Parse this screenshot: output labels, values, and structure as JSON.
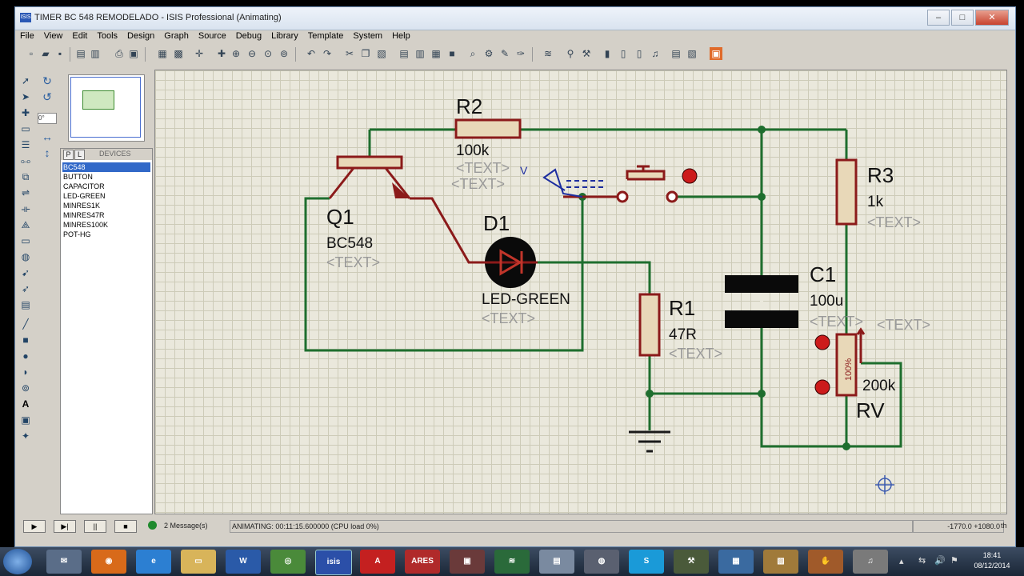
{
  "window": {
    "title": "TIMER BC 548 REMODELADO - ISIS Professional (Animating)",
    "icon": "isis-app-icon",
    "controls": {
      "minimize": "–",
      "maximize": "□",
      "close": "✕"
    }
  },
  "menu": [
    "File",
    "View",
    "Edit",
    "Tools",
    "Design",
    "Graph",
    "Source",
    "Debug",
    "Library",
    "Template",
    "System",
    "Help"
  ],
  "rotation_value": "0°",
  "devices": {
    "tab_p": "P",
    "tab_l": "L",
    "header": "DEVICES",
    "items": [
      "BC548",
      "BUTTON",
      "CAPACITOR",
      "LED-GREEN",
      "MINRES1K",
      "MINRES47R",
      "MINRES100K",
      "POT-HG"
    ],
    "selected_index": 0
  },
  "schematic": {
    "r2": {
      "ref": "R2",
      "value": "100k",
      "text": "<TEXT>"
    },
    "q1": {
      "ref": "Q1",
      "value": "BC548",
      "text": "<TEXT>"
    },
    "d1": {
      "ref": "D1",
      "value": "LED-GREEN",
      "text": "<TEXT>"
    },
    "r1": {
      "ref": "R1",
      "value": "47R",
      "text": "<TEXT>"
    },
    "r3": {
      "ref": "R3",
      "value": "1k",
      "text": "<TEXT>"
    },
    "c1": {
      "ref": "C1",
      "value": "100u",
      "text": "<TEXT>"
    },
    "rv": {
      "ref": "RV",
      "value": "200k",
      "text": "<TEXT>",
      "percent": "100%"
    },
    "probe_text": "<TEXT>",
    "probe_v": "V",
    "colors": {
      "wire": "#1e6e2e",
      "component": "#8b1a1a",
      "text_dim": "#9a9a9a",
      "probe": "#1d2ea0"
    }
  },
  "status": {
    "play": "▶",
    "step": "▶|",
    "pause": "||",
    "stop": "■",
    "messages": "2 Message(s)",
    "animating": "ANIMATING: 00:11:15.600000 (CPU load 0%)",
    "coords": "-1770.0   +1080.0",
    "unit": "th"
  },
  "taskbar": {
    "time": "18:41",
    "date": "08/12/2014",
    "apps": [
      "thunderbird",
      "firefox",
      "internet-explorer",
      "file-explorer",
      "word",
      "chrome",
      "isis",
      "acrobat",
      "ares",
      "app-window",
      "circuit-app",
      "notepad",
      "media-player",
      "skype",
      "tools",
      "photos",
      "paint",
      "unknown",
      "audio-app"
    ]
  }
}
